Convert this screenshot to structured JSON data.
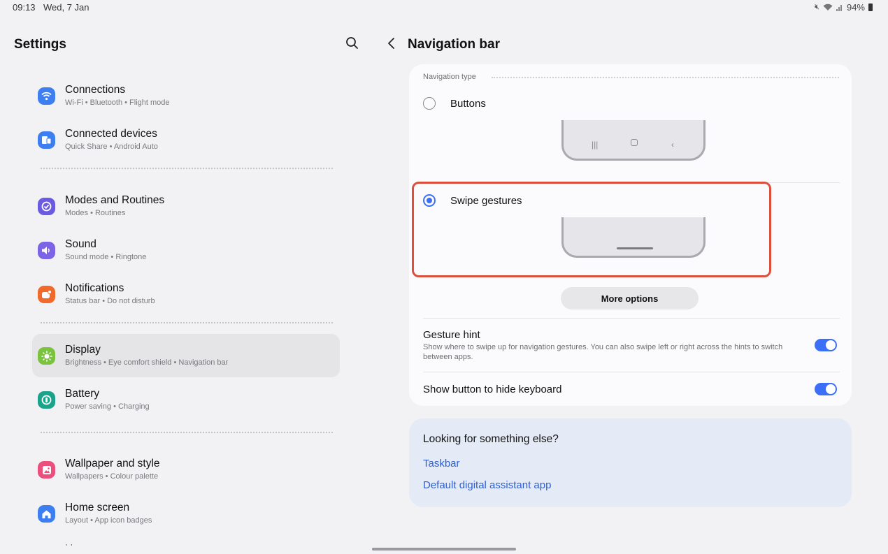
{
  "status_bar": {
    "time": "09:13",
    "date": "Wed, 7 Jan",
    "battery": "94%"
  },
  "left": {
    "title": "Settings",
    "items": [
      {
        "title": "Connections",
        "subtitle": "Wi-Fi  •  Bluetooth  •  Flight mode",
        "icon": "wifi-icon",
        "color": "#3d7ff0"
      },
      {
        "title": "Connected devices",
        "subtitle": "Quick Share  •  Android Auto",
        "icon": "devices-icon",
        "color": "#3d7ff0"
      },
      {
        "title": "Modes and Routines",
        "subtitle": "Modes  •  Routines",
        "icon": "check-circle-icon",
        "color": "#6b5be0"
      },
      {
        "title": "Sound",
        "subtitle": "Sound mode  •  Ringtone",
        "icon": "speaker-icon",
        "color": "#7d63e6"
      },
      {
        "title": "Notifications",
        "subtitle": "Status bar  •  Do not disturb",
        "icon": "notification-icon",
        "color": "#f06a2c"
      },
      {
        "title": "Display",
        "subtitle": "Brightness  •  Eye comfort shield  •  Navigation bar",
        "icon": "sun-icon",
        "color": "#7bc23f",
        "selected": true
      },
      {
        "title": "Battery",
        "subtitle": "Power saving  •  Charging",
        "icon": "battery-icon",
        "color": "#1aa38a"
      },
      {
        "title": "Wallpaper and style",
        "subtitle": "Wallpapers  •  Colour palette",
        "icon": "wallpaper-icon",
        "color": "#ec4f7e"
      },
      {
        "title": "Home screen",
        "subtitle": "Layout  •  App icon badges",
        "icon": "home-icon",
        "color": "#3d7ff0"
      }
    ]
  },
  "right": {
    "title": "Navigation bar",
    "section_label": "Navigation type",
    "option_buttons": "Buttons",
    "option_swipe": "Swipe gestures",
    "selected_option": "Swipe gestures",
    "more_options": "More options",
    "gesture_hint_title": "Gesture hint",
    "gesture_hint_desc": "Show where to swipe up for navigation gestures. You can also swipe left or right across the hints to switch between apps.",
    "gesture_hint_on": true,
    "hide_keyboard_title": "Show button to hide keyboard",
    "hide_keyboard_on": true
  },
  "looking": {
    "title": "Looking for something else?",
    "links": [
      "Taskbar",
      "Default digital assistant app"
    ]
  },
  "colors": {
    "accent": "#3b6ff5",
    "highlight": "#dc4f3d",
    "link": "#2f5fcf"
  }
}
